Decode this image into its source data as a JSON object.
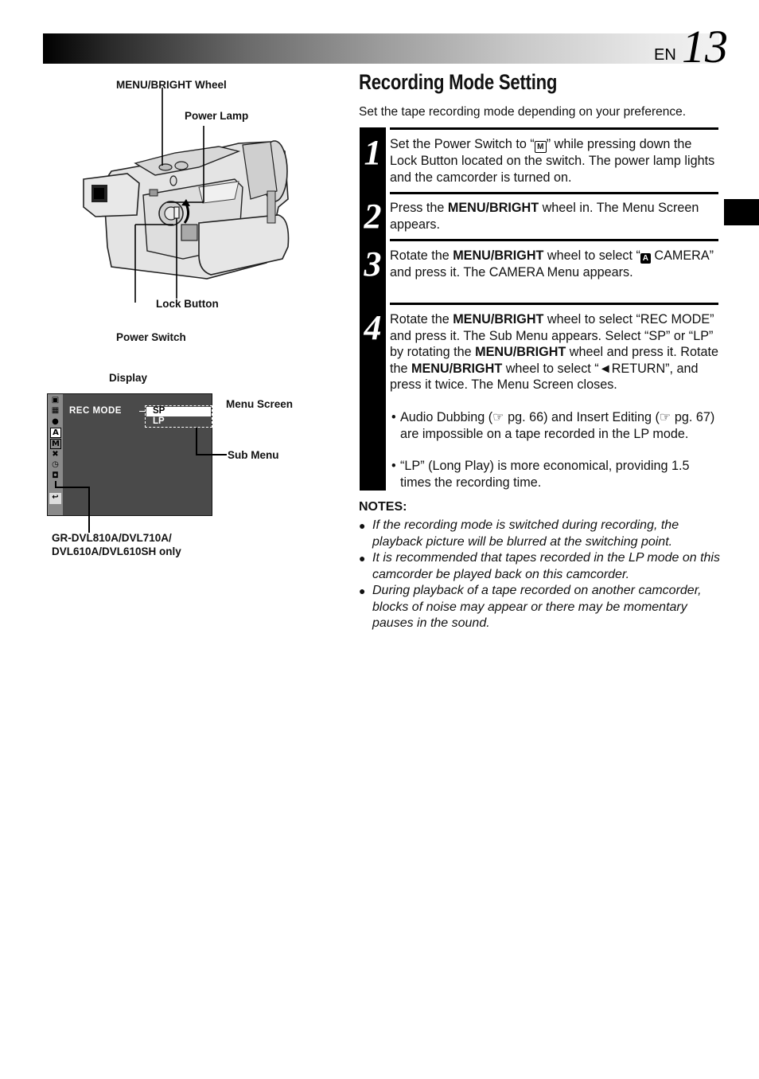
{
  "header": {
    "lang": "EN",
    "page_number": "13"
  },
  "section": {
    "title": "Recording Mode Setting",
    "intro": "Set the tape recording mode depending on your preference."
  },
  "steps": [
    {
      "number": "1",
      "parts": [
        "Set the Power Switch to “",
        "M",
        "” while pressing down the Lock Button located on the switch. The power lamp lights and the camcorder is turned on."
      ]
    },
    {
      "number": "2",
      "parts": [
        "Press the ",
        "MENU/BRIGHT",
        " wheel in. The Menu Screen appears."
      ]
    },
    {
      "number": "3",
      "parts": [
        "Rotate the ",
        "MENU/BRIGHT",
        " wheel to select “",
        "A",
        " CAMERA” and press it. The CAMERA Menu appears."
      ]
    },
    {
      "number": "4",
      "parts": [
        "Rotate the ",
        "MENU/BRIGHT",
        " wheel to select “REC MODE” and press it. The Sub Menu appears. Select “SP” or “LP” by rotating the ",
        "MENU/BRIGHT",
        " wheel and press it. Rotate the ",
        "MENU/BRIGHT",
        " wheel to select “◄RETURN”, and press it twice. The Menu Screen closes."
      ],
      "bullets": [
        "Audio Dubbing (☞ pg. 66) and Insert Editing (☞ pg. 67) are impossible on a tape recorded in the LP mode.",
        "“LP” (Long Play) is more economical, providing 1.5 times the recording time."
      ]
    }
  ],
  "notes": {
    "title": "NOTES:",
    "items": [
      "If the recording mode is switched during recording, the playback picture will be blurred at the switching point.",
      "It is recommended that tapes recorded in the LP mode on this camcorder be played back on this camcorder.",
      "During playback of a tape recorded on another camcorder, blocks of noise may appear or there may be momentary pauses in the sound."
    ]
  },
  "camera_figure": {
    "labels": {
      "menu_bright_wheel": "MENU/BRIGHT Wheel",
      "power_lamp": "Power Lamp",
      "lock_button": "Lock Button",
      "power_switch": "Power Switch"
    }
  },
  "display_figure": {
    "caption": "Display",
    "menu_screen_label": "Menu Screen",
    "sub_menu_label": "Sub Menu",
    "menu_item": "REC MODE",
    "options": [
      "SP",
      "LP"
    ],
    "selected_option": "SP",
    "side_icons": [
      "screen-icon",
      "film-icon",
      "person-icon",
      "camera-auto-icon",
      "manual-icon",
      "camera-question-icon",
      "clock-icon",
      "snapshot-icon",
      "return-icon"
    ],
    "model_note_line1": "GR-DVL810A/DVL710A/",
    "model_note_line2": "DVL610A/DVL610SH only"
  },
  "glyphs": {
    "bullet": "•",
    "note_bullet": "●",
    "manual_badge": "M",
    "auto_badge": "A",
    "icon_a": "A",
    "icon_m": "M",
    "icon_return": "↩",
    "icon_clock": "◷",
    "icon_camera": "◘"
  }
}
